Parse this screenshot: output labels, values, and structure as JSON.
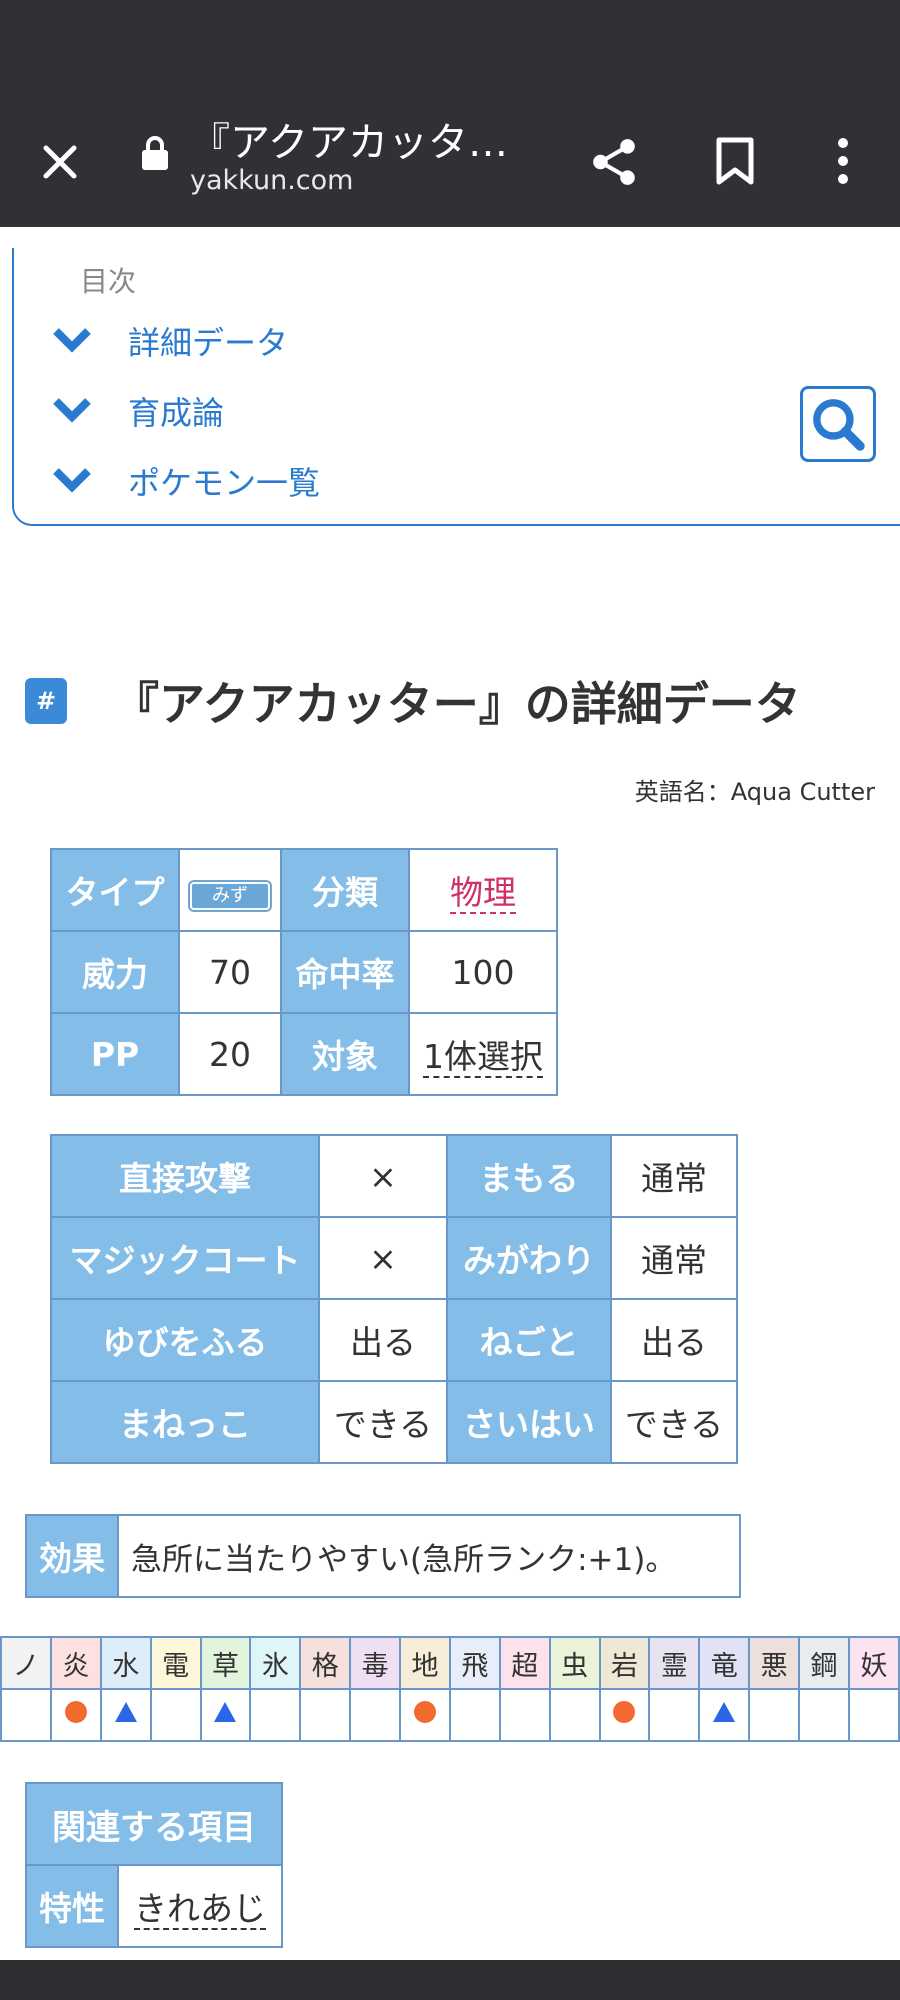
{
  "browser": {
    "title": "『アクアカッタ…",
    "url": "yakkun.com"
  },
  "toc": {
    "title": "目次",
    "items": [
      "詳細データ",
      "育成論",
      "ポケモン一覧"
    ]
  },
  "heading": {
    "hash": "#",
    "text": "『アクアカッター』の詳細データ"
  },
  "english_name": "英語名：Aqua  Cutter",
  "move_table": {
    "type_label": "タイプ",
    "type_value": "みず",
    "category_label": "分類",
    "category_value": "物理",
    "power_label": "威力",
    "power_value": "70",
    "accuracy_label": "命中率",
    "accuracy_value": "100",
    "pp_label": "PP",
    "pp_value": "20",
    "target_label": "対象",
    "target_value": "1体選択"
  },
  "flags_table": {
    "rows": [
      {
        "l1": "直接攻撃",
        "v1": "×",
        "l2": "まもる",
        "v2": "通常"
      },
      {
        "l1": "マジックコート",
        "v1": "×",
        "l2": "みがわり",
        "v2": "通常"
      },
      {
        "l1": "ゆびをふる",
        "v1": "出る",
        "l2": "ねごと",
        "v2": "出る"
      },
      {
        "l1": "まねっこ",
        "v1": "できる",
        "l2": "さいはい",
        "v2": "できる"
      }
    ]
  },
  "effect": {
    "label": "効果",
    "text": "急所に当たりやすい(急所ランク:+1)。"
  },
  "type_chart": {
    "types": [
      "ノ",
      "炎",
      "水",
      "電",
      "草",
      "氷",
      "格",
      "毒",
      "地",
      "飛",
      "超",
      "虫",
      "岩",
      "霊",
      "竜",
      "悪",
      "鋼",
      "妖"
    ],
    "colors": [
      "#f2f2f2",
      "#fde0e0",
      "#ddeefa",
      "#fdf6d8",
      "#e2f4dc",
      "#e0f5f7",
      "#f6e0dc",
      "#eedff2",
      "#f6ecd8",
      "#e7eefa",
      "#fde2ec",
      "#eaf2d8",
      "#efe8d6",
      "#e6e2f0",
      "#e2e2f6",
      "#ecdfdc",
      "#e8ecef",
      "#fbe4f0"
    ],
    "marks": [
      "",
      "circle",
      "triangle",
      "",
      "triangle",
      "",
      "",
      "",
      "circle",
      "",
      "",
      "",
      "circle",
      "",
      "triangle",
      "",
      "",
      ""
    ],
    "circle_color": "#f26a2e",
    "triangle_color": "#2c66e8"
  },
  "related": {
    "header": "関連する項目",
    "label": "特性",
    "value": "きれあじ"
  }
}
